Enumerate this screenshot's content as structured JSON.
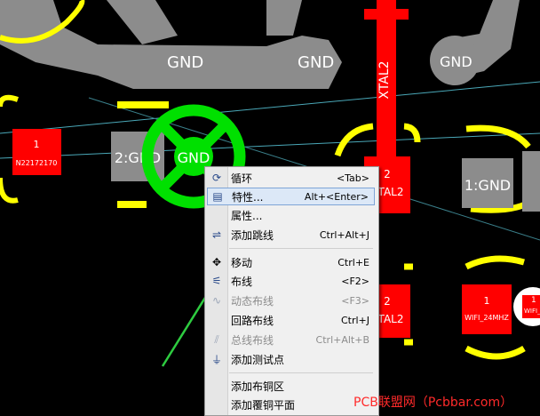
{
  "board": {
    "labels": {
      "gnd_top_left": "GND",
      "gnd_top_right": "GND",
      "gnd_far_right": "GND",
      "xtal_vertical": "XTAL2",
      "pad1_left_num": "1",
      "pad1_left_net": "N22172170",
      "pad2_left": "2:GND",
      "pad_center": "GND",
      "xtal_pad_top_num": "2",
      "xtal_pad_top_net": "XTAL2",
      "pad_right_gnd": "1:GND",
      "xtal_pad_bottom_num": "2",
      "xtal_pad_bottom_net": "XTAL2",
      "pad_right_bottom_num": "1",
      "pad_right_bottom_net": "WIFI_24MHZ",
      "pad_far_right_num": "1",
      "pad_far_right_net": "WIFI_"
    },
    "colors": {
      "copper_gray": "#8c8c8c",
      "pad_red": "#ff0000",
      "silk_yellow": "#ffff00",
      "highlight_green": "#00e000",
      "ratsnest": "#4aa8b8"
    }
  },
  "context_menu": {
    "items": [
      {
        "label": "循环",
        "shortcut": "<Tab>",
        "icon": "cycle-icon",
        "enabled": true
      },
      {
        "label": "特性...",
        "shortcut": "Alt+<Enter>",
        "icon": "properties-icon",
        "enabled": true,
        "highlighted": true
      },
      {
        "label": "属性...",
        "shortcut": "",
        "icon": "",
        "enabled": true
      },
      {
        "label": "添加跳线",
        "shortcut": "Ctrl+Alt+J",
        "icon": "add-jumper-icon",
        "enabled": true
      },
      {
        "label": "移动",
        "shortcut": "Ctrl+E",
        "icon": "move-icon",
        "enabled": true
      },
      {
        "label": "布线",
        "shortcut": "<F2>",
        "icon": "route-icon",
        "enabled": true
      },
      {
        "label": "动态布线",
        "shortcut": "<F3>",
        "icon": "dynamic-route-icon",
        "enabled": false
      },
      {
        "label": "回路布线",
        "shortcut": "Ctrl+J",
        "icon": "",
        "enabled": true
      },
      {
        "label": "总线布线",
        "shortcut": "Ctrl+Alt+B",
        "icon": "bus-route-icon",
        "enabled": false
      },
      {
        "label": "添加测试点",
        "shortcut": "",
        "icon": "test-point-icon",
        "enabled": true
      },
      {
        "label": "添加布铜区",
        "shortcut": "",
        "icon": "",
        "enabled": true
      },
      {
        "label": "添加覆铜平面",
        "shortcut": "",
        "icon": "",
        "enabled": true
      }
    ]
  },
  "watermark": "PCB联盟网（Pcbbar.com）"
}
